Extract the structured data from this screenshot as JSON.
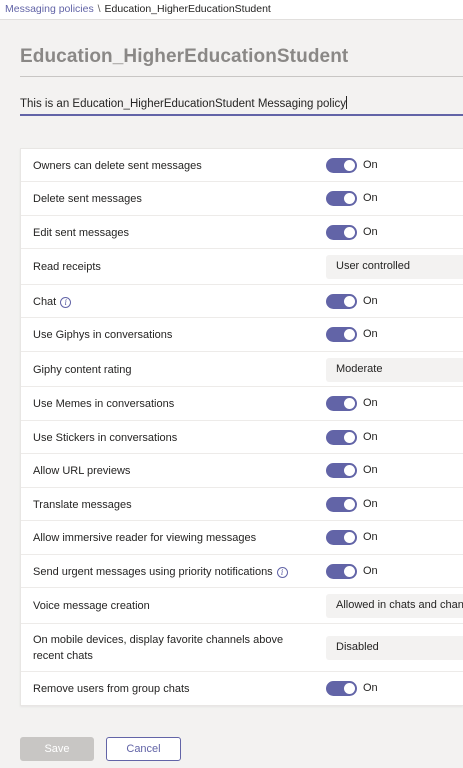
{
  "breadcrumb": {
    "parent": "Messaging policies",
    "separator": "\\",
    "current": "Education_HigherEducationStudent"
  },
  "title": "Education_HigherEducationStudent",
  "description_field": {
    "value": "This is an Education_HigherEducationStudent Messaging policy"
  },
  "settings": [
    {
      "label": "Owners can delete sent messages",
      "type": "toggle",
      "value": "On"
    },
    {
      "label": "Delete sent messages",
      "type": "toggle",
      "value": "On"
    },
    {
      "label": "Edit sent messages",
      "type": "toggle",
      "value": "On"
    },
    {
      "label": "Read receipts",
      "type": "dropdown",
      "value": "User controlled"
    },
    {
      "label": "Chat",
      "type": "toggle",
      "value": "On",
      "info": true
    },
    {
      "label": "Use Giphys in conversations",
      "type": "toggle",
      "value": "On"
    },
    {
      "label": "Giphy content rating",
      "type": "dropdown",
      "value": "Moderate"
    },
    {
      "label": "Use Memes in conversations",
      "type": "toggle",
      "value": "On"
    },
    {
      "label": "Use Stickers in conversations",
      "type": "toggle",
      "value": "On"
    },
    {
      "label": "Allow URL previews",
      "type": "toggle",
      "value": "On"
    },
    {
      "label": "Translate messages",
      "type": "toggle",
      "value": "On"
    },
    {
      "label": "Allow immersive reader for viewing messages",
      "type": "toggle",
      "value": "On"
    },
    {
      "label": "Send urgent messages using priority notifications",
      "type": "toggle",
      "value": "On",
      "info": true
    },
    {
      "label": "Voice message creation",
      "type": "dropdown",
      "value": "Allowed in chats and channels"
    },
    {
      "label": "On mobile devices, display favorite channels above",
      "label_line2": "recent chats",
      "type": "dropdown",
      "value": "Disabled"
    },
    {
      "label": "Remove users from group chats",
      "type": "toggle",
      "value": "On"
    }
  ],
  "buttons": {
    "save": "Save",
    "cancel": "Cancel"
  },
  "colors": {
    "accent": "#6264a7",
    "background": "#f3f2f1",
    "disabled_button": "#c8c6c4"
  }
}
